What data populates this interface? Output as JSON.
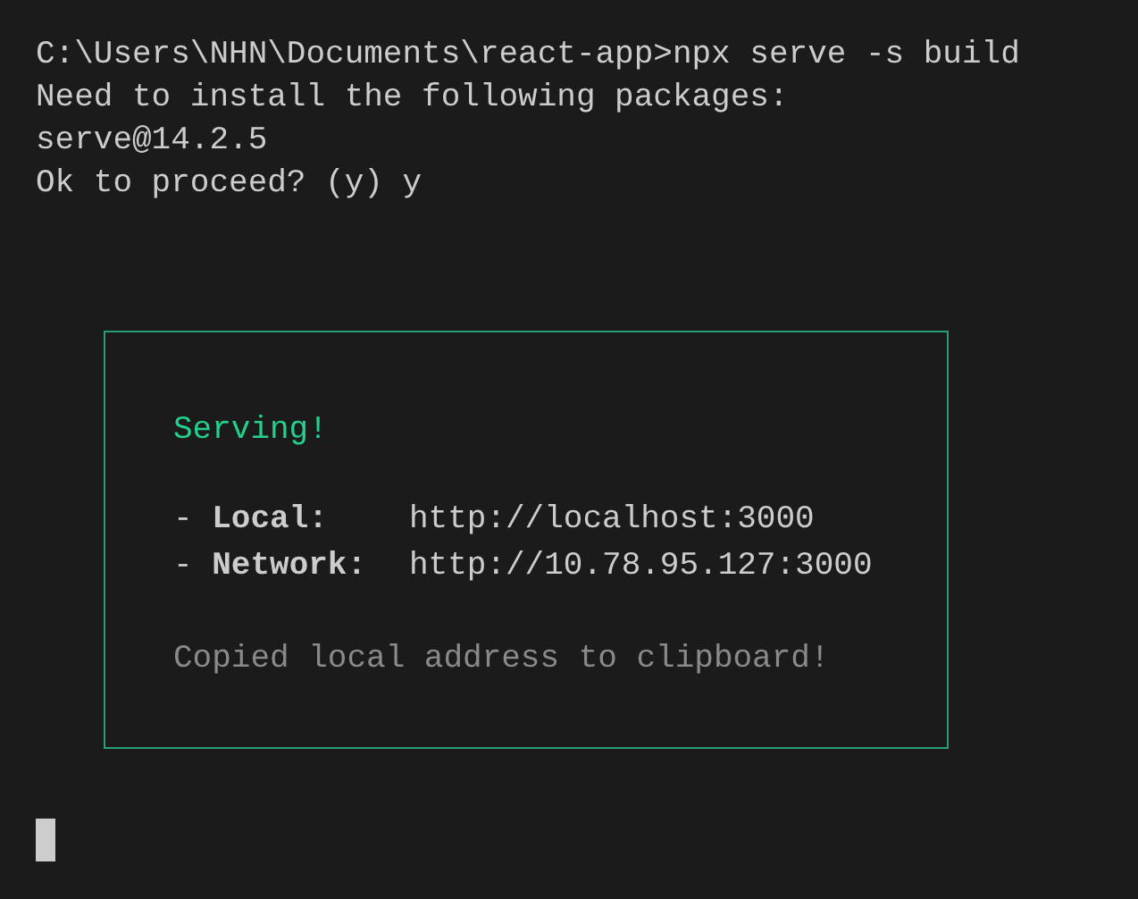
{
  "terminal": {
    "lines": [
      "C:\\Users\\NHN\\Documents\\react-app>npx serve -s build",
      "Need to install the following packages:",
      "serve@14.2.5",
      "Ok to proceed? (y) y"
    ],
    "box": {
      "title": "Serving!",
      "entries": [
        {
          "label": "- **Local:**",
          "value": "http://localhost:3000"
        },
        {
          "label": "- **Network:**",
          "value": "http://10.78.95.127:3000"
        }
      ],
      "note": "Copied local address to clipboard!"
    }
  }
}
